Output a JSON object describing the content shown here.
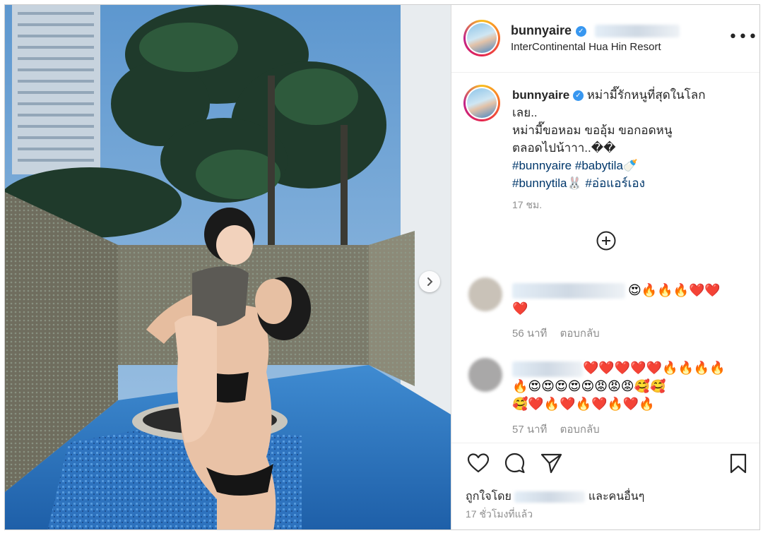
{
  "post": {
    "username": "bunnyaire",
    "location": "InterContinental Hua Hin Resort",
    "caption_lines": [
      "หม่ามี๊รักหนูที่สุดในโลก",
      "เลย..",
      "หม่ามี๊ขอหอม ขออุ้ม ขอกอดหนู",
      "ตลอดไปน้าาา..��"
    ],
    "hashtags": [
      "#bunnyaire",
      "#babytila",
      "#bunnytila",
      "#อ่อแอร์เอง"
    ],
    "tag_emojis": [
      "🍼",
      "🐰"
    ],
    "caption_time": "17 ชม.",
    "liked_prefix": "ถูกใจโดย",
    "liked_suffix": "และคนอื่นๆ",
    "posted_ago": "17 ชั่วโมงที่แล้ว"
  },
  "comments": [
    {
      "emoji_line1": "😍🔥🔥🔥❤️❤️",
      "emoji_line2": "❤️",
      "time": "56 นาที",
      "reply_label": "ตอบกลับ"
    },
    {
      "emoji_line1": "❤️❤️❤️❤️❤️🔥🔥🔥🔥",
      "emoji_line2": "🔥😍😍😍😍😍😡😡😡🥰🥰",
      "emoji_line3": "🥰❤️🔥❤️🔥❤️🔥❤️🔥",
      "time": "57 นาที",
      "reply_label": "ตอบกลับ"
    }
  ],
  "icons": {
    "verified": "verified-badge-icon",
    "more": "more-options-icon",
    "next": "chevron-right-icon",
    "expand": "plus-circle-icon",
    "like": "heart-icon",
    "comment": "comment-icon",
    "share": "send-icon",
    "save": "bookmark-icon"
  },
  "colors": {
    "accent": "#3897f0",
    "hashtag": "#00376b",
    "muted": "#8e8e8e",
    "text": "#262626"
  }
}
